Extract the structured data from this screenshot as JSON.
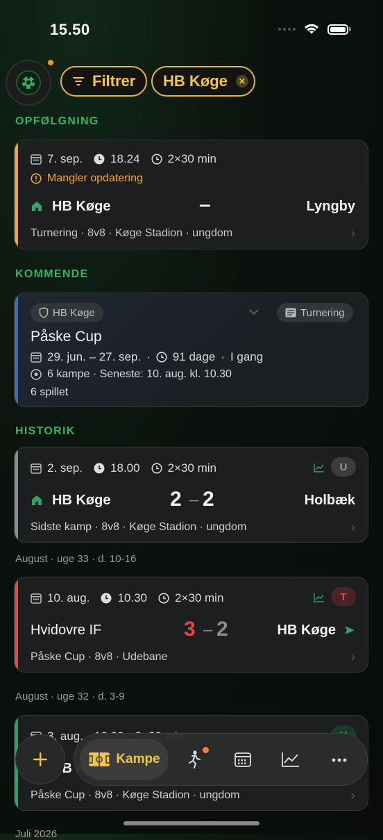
{
  "status": {
    "time": "15.50"
  },
  "filters": {
    "filter_label": "Filtrer",
    "club_label": "HB Køge"
  },
  "sections": {
    "followup": "OPFØLGNING",
    "upcoming": "KOMMENDE",
    "history": "HISTORIK"
  },
  "followup_match": {
    "date": "7. sep.",
    "time": "18.24",
    "duration": "2×30 min",
    "warning": "Mangler opdatering",
    "home": "HB Køge",
    "score": "–",
    "away": "Lyngby",
    "details": "Turnering · 8v8 · Køge Stadion · ungdom",
    "accent": "#f2a72a"
  },
  "tournament": {
    "club": "HB Køge",
    "type": "Turnering",
    "name": "Påske Cup",
    "dates": "29. jun. – 27. sep.",
    "duration": "91 dage",
    "status": "I gang",
    "matches": "6 kampe · Seneste: 10. aug. kl. 10.30",
    "played": "6 spillet",
    "accent": "#3a6fb0"
  },
  "history": [
    {
      "date": "2. sep.",
      "time": "18.00",
      "duration": "2×30 min",
      "badge": "U",
      "home": "HB Køge",
      "home_score": "2",
      "away_score": "2",
      "away": "Holbæk",
      "details": "Sidste kamp · 8v8 · Køge Stadion · ungdom",
      "accent": "#8a8d8f"
    },
    {
      "week": "August · uge 33 · d. 10-16",
      "date": "10. aug.",
      "time": "10.30",
      "duration": "2×30 min",
      "badge": "T",
      "home": "Hvidovre IF",
      "home_score": "3",
      "away_score": "2",
      "away": "HB Køge",
      "details": "Påske Cup · 8v8 · Udebane",
      "accent": "#e0484b"
    },
    {
      "week": "August · uge 32 · d. 3-9",
      "date": "3. aug.",
      "time": "10.00",
      "duration": "2×30 min",
      "badge": "V",
      "home": "HB Køge",
      "details": "Påske Cup · 8v8 · Køge Stadion · ungdom",
      "accent": "#27a36a"
    }
  ],
  "next_month": "Juli 2026",
  "tabbar": {
    "active_label": "Kampe"
  },
  "colors": {
    "accent_yellow": "#f2c644",
    "section_green": "#36b35e",
    "loss_red": "#e0484b"
  }
}
